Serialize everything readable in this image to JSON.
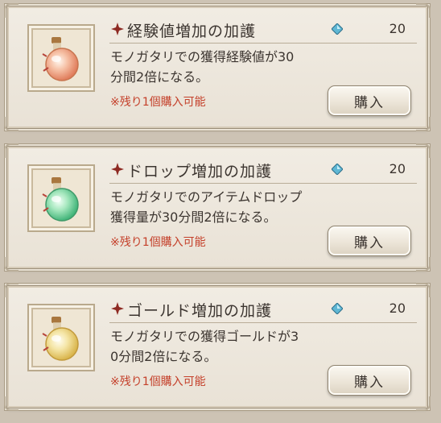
{
  "items": [
    {
      "title": "経験値増加の加護",
      "price": "20",
      "description": "モノガタリでの獲得経験値が30\n分間2倍になる。",
      "remaining": "※残り1個購入可能",
      "buy_label": "購入",
      "potion_color": "#f2a98a",
      "icon": "potion-icon",
      "currency_icon": "gem-icon"
    },
    {
      "title": "ドロップ増加の加護",
      "price": "20",
      "description": "モノガタリでのアイテムドロップ\n獲得量が30分間2倍になる。",
      "remaining": "※残り1個購入可能",
      "buy_label": "購入",
      "potion_color": "#7fd9a2",
      "icon": "potion-icon",
      "currency_icon": "gem-icon"
    },
    {
      "title": "ゴールド増加の加護",
      "price": "20",
      "description": "モノガタリでの獲得ゴールドが3\n0分間2倍になる。",
      "remaining": "※残り1個購入可能",
      "buy_label": "購入",
      "potion_color": "#f0d985",
      "icon": "potion-icon",
      "currency_icon": "gem-icon"
    }
  ],
  "colors": {
    "remaining_text": "#c4402a",
    "title_mark": "#8e2a23",
    "gem": "#5fb7d4"
  }
}
